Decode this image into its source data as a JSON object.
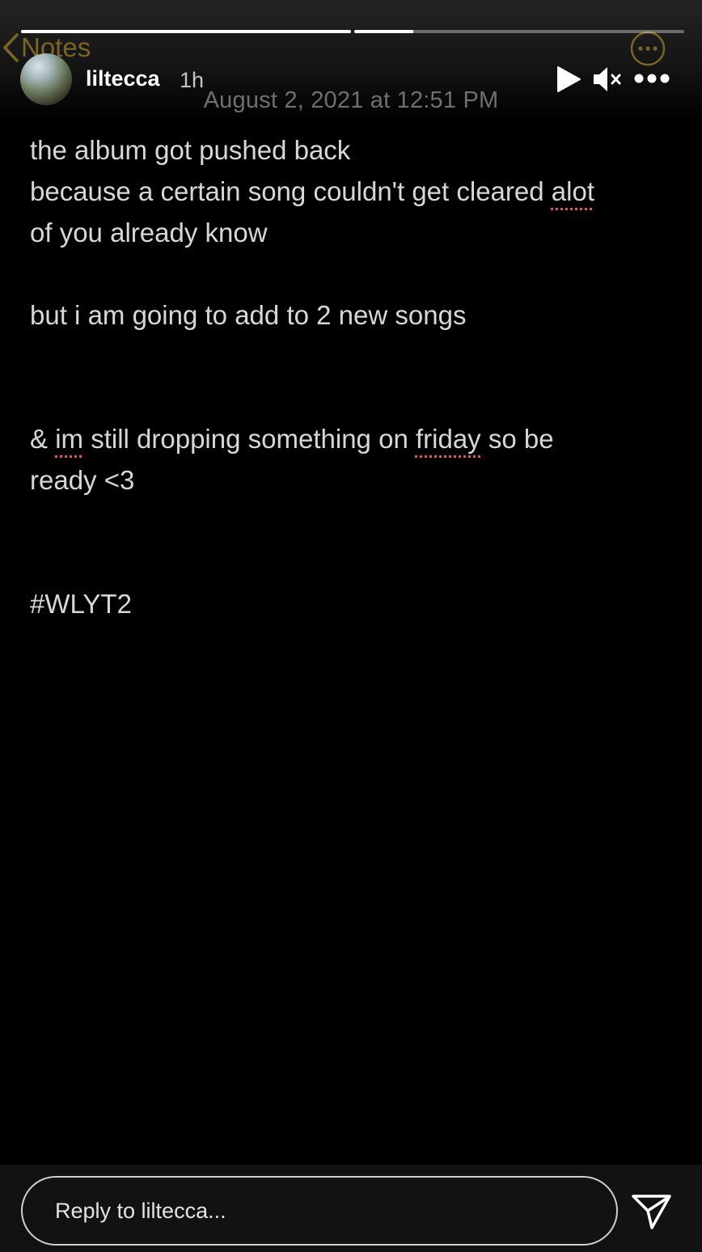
{
  "notes_app": {
    "back_label": "Notes",
    "date": "August 2, 2021 at 12:51 PM"
  },
  "story": {
    "username": "liltecca",
    "time_ago": "1h",
    "progress_fraction": [
      1.0,
      0.18
    ]
  },
  "note": {
    "lines": [
      "the album got pushed back",
      "because a certain song couldn't get cleared alot",
      "of you already know",
      "",
      "but i am going to add to 2 new songs",
      "",
      "",
      "& im still dropping something on friday so be",
      "ready <3",
      "",
      "",
      "#WLYT2"
    ],
    "misspelled_words": [
      "alot",
      "im",
      "friday"
    ]
  },
  "reply": {
    "placeholder": "Reply to liltecca..."
  },
  "icons": {
    "play": "play-icon",
    "mute": "speaker-muted-icon",
    "more": "more-horizontal-icon",
    "send": "send-paper-plane-icon",
    "notes_back": "chevron-left-icon",
    "notes_more": "ellipsis-circle-icon"
  },
  "colors": {
    "notes_accent": "#7b6524",
    "misspelling_underline": "#e25555"
  }
}
